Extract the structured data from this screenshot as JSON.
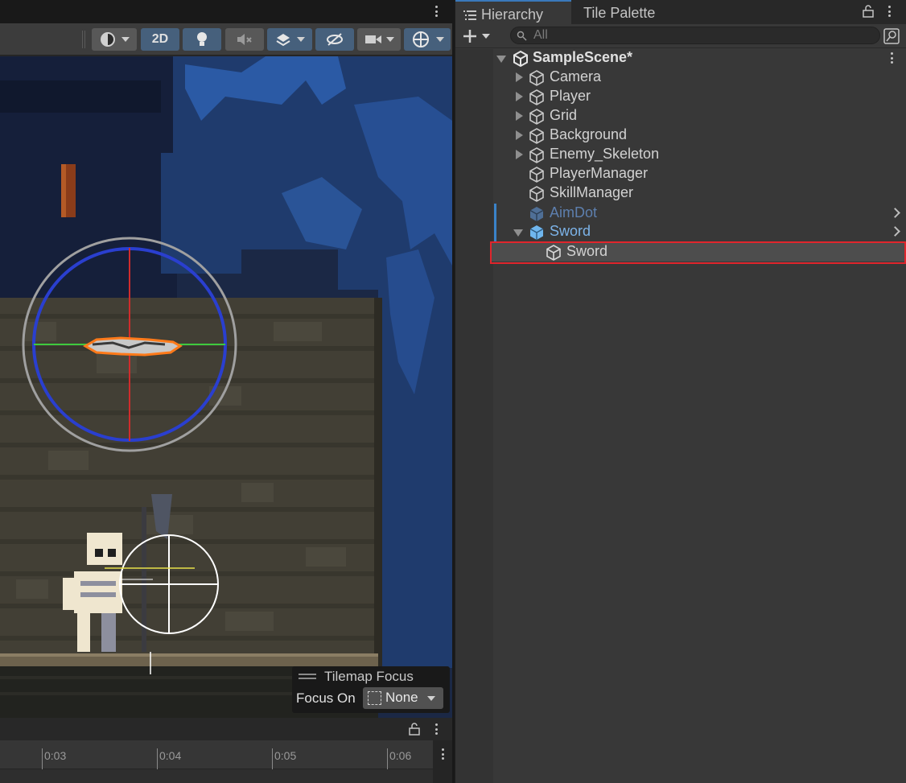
{
  "scene_toolbar": {
    "btn_2d": "2D"
  },
  "tilemap_focus": {
    "title": "Tilemap Focus",
    "focus_label": "Focus On",
    "focus_value": "None"
  },
  "timeline": {
    "ticks": [
      "0:03",
      "0:04",
      "0:05",
      "0:06"
    ]
  },
  "hierarchy": {
    "tabs": [
      "Hierarchy",
      "Tile Palette"
    ],
    "search_placeholder": "All",
    "scene_name": "SampleScene*",
    "items": [
      {
        "label": "Camera"
      },
      {
        "label": "Player"
      },
      {
        "label": "Grid"
      },
      {
        "label": "Background"
      },
      {
        "label": "Enemy_Skeleton"
      },
      {
        "label": "PlayerManager"
      },
      {
        "label": "SkillManager"
      },
      {
        "label": "AimDot"
      },
      {
        "label": "Sword"
      },
      {
        "label": "Sword"
      }
    ]
  },
  "colors": {
    "selection_outline": "#e0252c",
    "prefab_text": "#7cb3e8",
    "toggle_active": "#46607c",
    "gizmo_x": "#3ec93e",
    "gizmo_y": "#d02c2c",
    "gizmo_circle": "#2a3fcf"
  },
  "icons": [
    "menu-kebab-icon",
    "shading-mode-icon",
    "lighting-icon",
    "audio-mute-icon",
    "effects-icon",
    "visibility-icon",
    "camera-icon",
    "gizmos-icon",
    "list-icon",
    "lock-icon",
    "plus-icon",
    "search-icon",
    "scene-unity-icon",
    "gameobject-cube-icon",
    "prefab-cube-icon"
  ]
}
